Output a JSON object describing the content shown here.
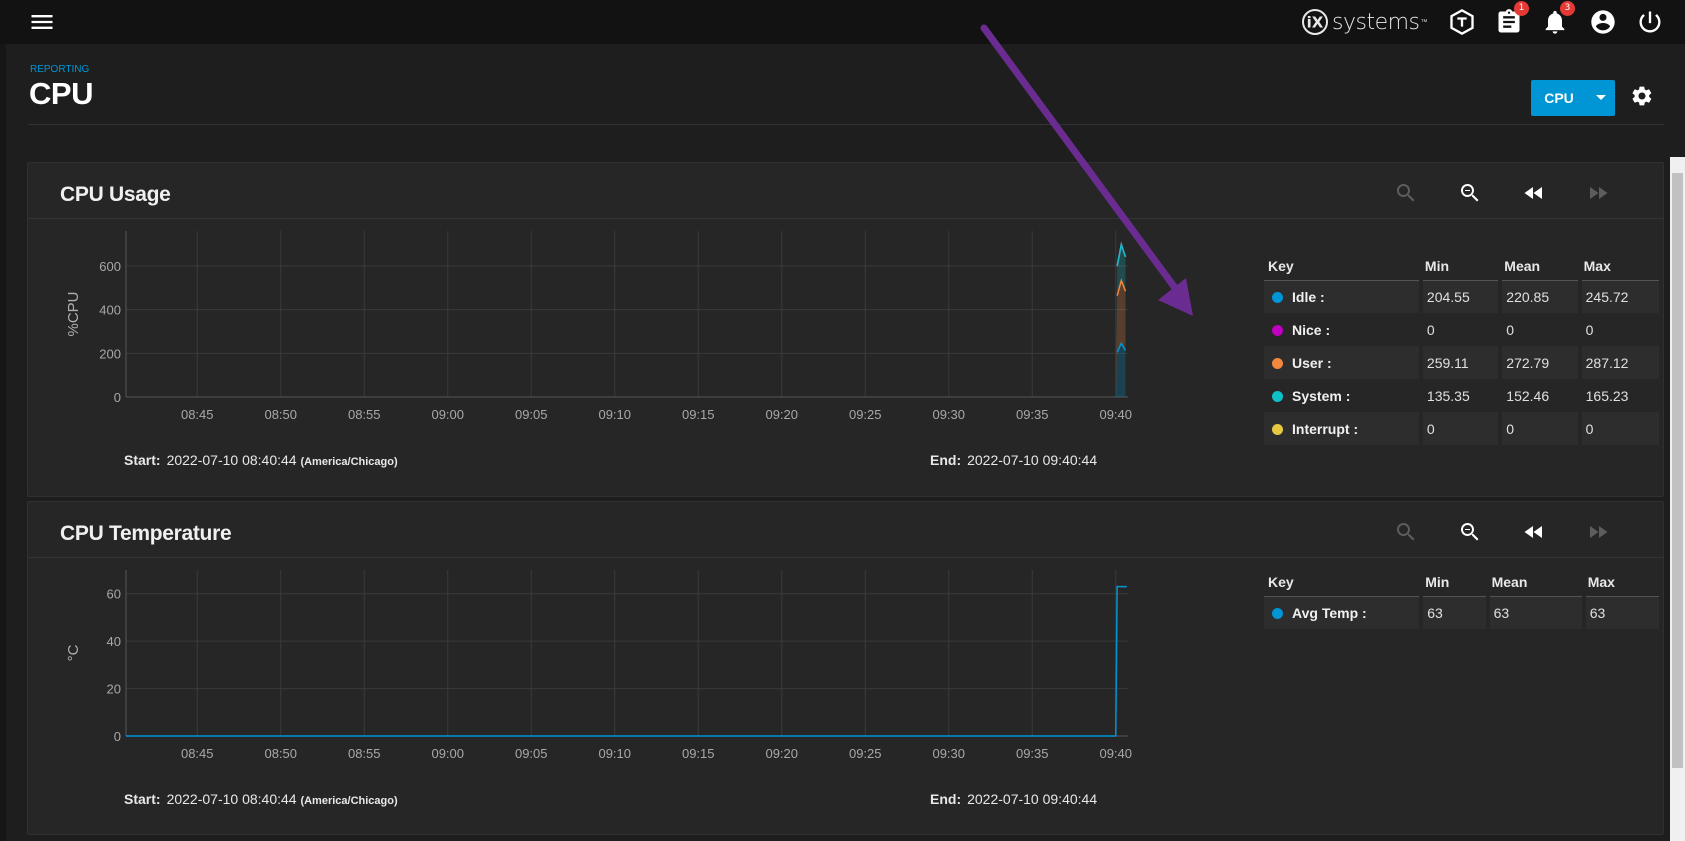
{
  "topbar": {
    "logo_text": "systems",
    "logo_mark": "iX",
    "tasks_badge": "1",
    "alerts_badge": "3",
    "icons": [
      "menu-icon",
      "truecommand-icon",
      "clipboard-icon",
      "bell-icon",
      "account-circle-icon",
      "power-icon"
    ]
  },
  "page": {
    "breadcrumb": "REPORTING",
    "title": "CPU",
    "select_label": "CPU"
  },
  "colors": {
    "accent": "#0095d5",
    "badge": "#e53935",
    "annotation_arrow": "#6a2c91"
  },
  "cards": [
    {
      "title": "CPU Usage",
      "start_label": "Start:",
      "start_value": "2022-07-10 08:40:44",
      "timezone": "(America/Chicago)",
      "end_label": "End:",
      "end_value": "2022-07-10 09:40:44",
      "legend": {
        "headers": [
          "Key",
          "Min",
          "Mean",
          "Max"
        ],
        "rows": [
          {
            "name": "Idle :",
            "color": "#0095d5",
            "min": "204.55",
            "mean": "220.85",
            "max": "245.72"
          },
          {
            "name": "Nice :",
            "color": "#c000c0",
            "min": "0",
            "mean": "0",
            "max": "0"
          },
          {
            "name": "User :",
            "color": "#f0883e",
            "min": "259.11",
            "mean": "272.79",
            "max": "287.12"
          },
          {
            "name": "System :",
            "color": "#10c0c8",
            "min": "135.35",
            "mean": "152.46",
            "max": "165.23"
          },
          {
            "name": "Interrupt :",
            "color": "#e8c840",
            "min": "0",
            "mean": "0",
            "max": "0"
          }
        ]
      }
    },
    {
      "title": "CPU Temperature",
      "start_label": "Start:",
      "start_value": "2022-07-10 08:40:44",
      "timezone": "(America/Chicago)",
      "end_label": "End:",
      "end_value": "2022-07-10 09:40:44",
      "legend": {
        "headers": [
          "Key",
          "Min",
          "Mean",
          "Max"
        ],
        "rows": [
          {
            "name": "Avg Temp :",
            "color": "#0095d5",
            "min": "63",
            "mean": "63",
            "max": "63"
          }
        ]
      }
    }
  ],
  "chart_data": [
    {
      "type": "area",
      "ylabel": "%CPU",
      "ylim": [
        0,
        760
      ],
      "yticks": [
        0,
        200,
        400,
        600
      ],
      "xlim": [
        "08:40:44",
        "09:40:44"
      ],
      "xticks": [
        "08:45",
        "08:50",
        "08:55",
        "09:00",
        "09:05",
        "09:10",
        "09:15",
        "09:20",
        "09:25",
        "09:30",
        "09:35",
        "09:40"
      ],
      "stacked": true,
      "grid": true,
      "series": [
        {
          "name": "Idle",
          "color": "#0095d5",
          "x": [
            "09:40:05",
            "09:40:20",
            "09:40:35"
          ],
          "values": [
            204.55,
            245.72,
            212.3
          ]
        },
        {
          "name": "User",
          "color": "#f0883e",
          "x": [
            "09:40:05",
            "09:40:20",
            "09:40:35"
          ],
          "values": [
            259.11,
            287.12,
            272.1
          ]
        },
        {
          "name": "System",
          "color": "#10c0c8",
          "x": [
            "09:40:05",
            "09:40:20",
            "09:40:35"
          ],
          "values": [
            135.35,
            165.23,
            156.8
          ]
        },
        {
          "name": "Nice",
          "color": "#c000c0",
          "x": [
            "09:40:05",
            "09:40:20",
            "09:40:35"
          ],
          "values": [
            0,
            0,
            0
          ]
        },
        {
          "name": "Interrupt",
          "color": "#e8c840",
          "x": [
            "09:40:05",
            "09:40:20",
            "09:40:35"
          ],
          "values": [
            0,
            0,
            0
          ]
        }
      ]
    },
    {
      "type": "line",
      "ylabel": "°C",
      "ylim": [
        0,
        70
      ],
      "yticks": [
        0,
        20,
        40,
        60
      ],
      "xlim": [
        "08:40:44",
        "09:40:44"
      ],
      "xticks": [
        "08:45",
        "08:50",
        "08:55",
        "09:00",
        "09:05",
        "09:10",
        "09:15",
        "09:20",
        "09:25",
        "09:30",
        "09:35",
        "09:40"
      ],
      "grid": true,
      "series": [
        {
          "name": "Avg Temp",
          "color": "#0095d5",
          "x": [
            "08:40:44",
            "09:40:00",
            "09:40:05",
            "09:40:40"
          ],
          "values": [
            0,
            0,
            63,
            63
          ]
        }
      ]
    }
  ]
}
